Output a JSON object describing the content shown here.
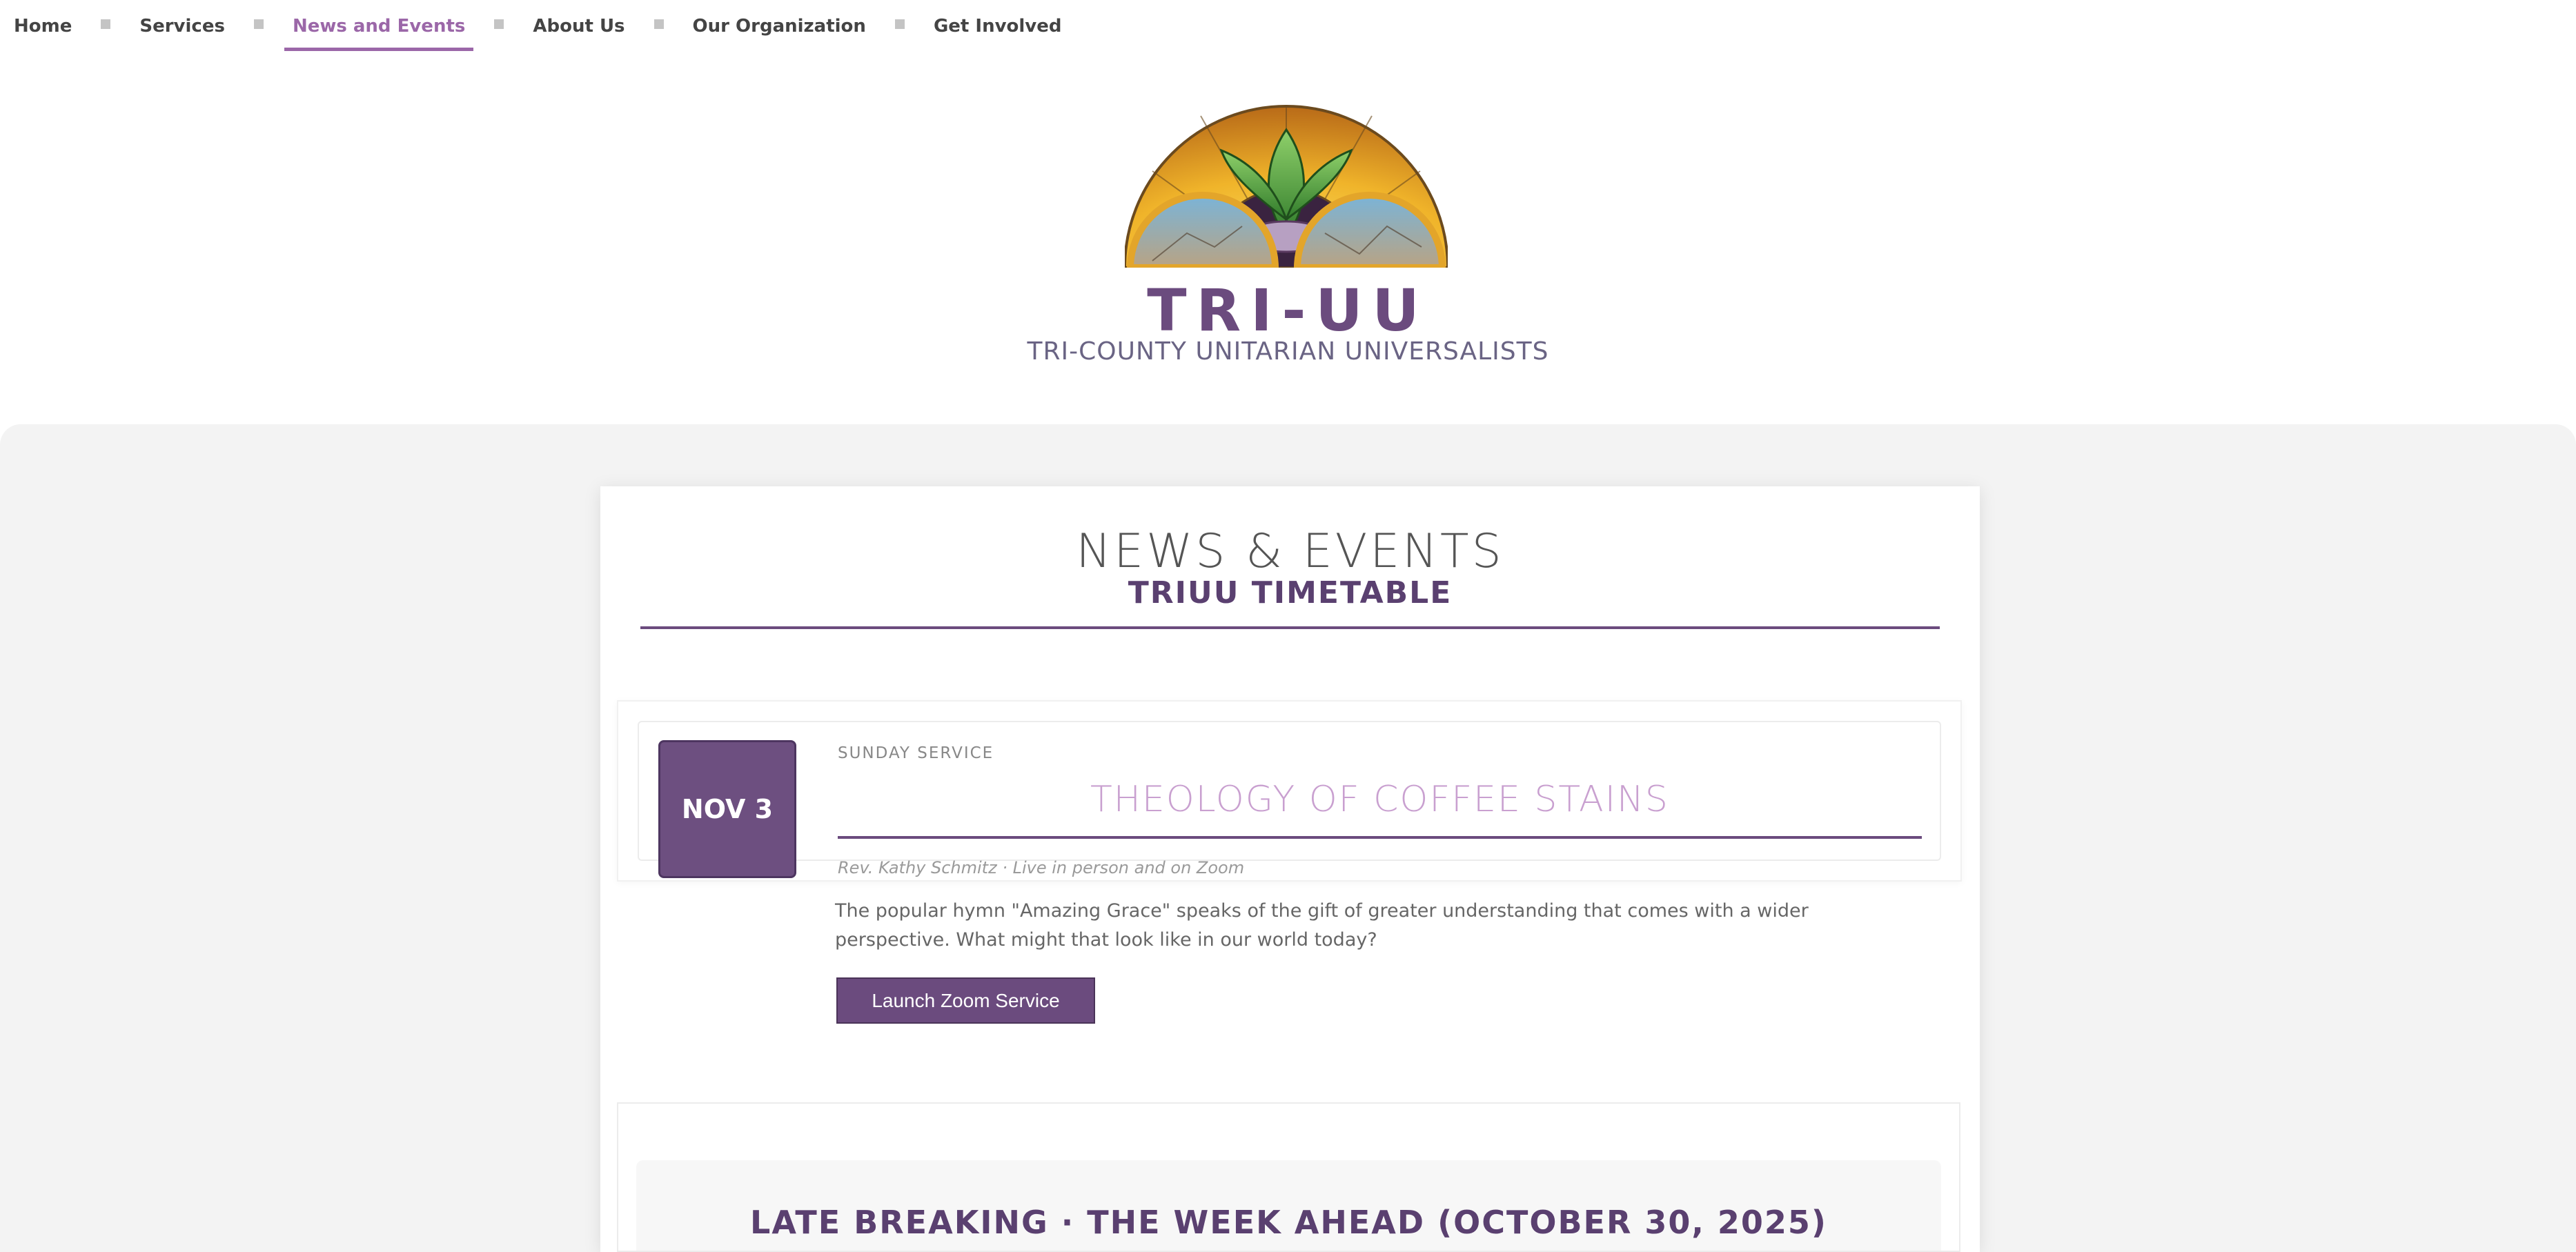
{
  "nav": {
    "items": [
      {
        "label": "Home"
      },
      {
        "label": "Services"
      },
      {
        "label": "News and Events",
        "active": true
      },
      {
        "label": "About Us"
      },
      {
        "label": "Our Organization"
      },
      {
        "label": "Get Involved"
      }
    ]
  },
  "brand": {
    "title": "TRI-UU",
    "subtitle": "TRI-COUNTY UNITARIAN UNIVERSALISTS"
  },
  "main": {
    "heading": "NEWS & EVENTS",
    "subheading": "TRIUU TIMETABLE"
  },
  "event": {
    "date": "NOV 3",
    "type": "SUNDAY SERVICE",
    "title": "THEOLOGY OF COFFEE STAINS",
    "meta": "Rev. Kathy Schmitz · Live in person and on Zoom",
    "description": "The popular hymn \"Amazing Grace\" speaks of the gift of greater understanding that comes with a wider perspective. What might that look like in our world today?",
    "button_label": "Launch Zoom Service"
  },
  "week_ahead": {
    "title": "LATE BREAKING · THE WEEK AHEAD (OCTOBER 30, 2025)"
  },
  "colors": {
    "accent": "#6b4b7e",
    "nav_active": "#9b67a8",
    "event_title": "#c9a0d0"
  }
}
